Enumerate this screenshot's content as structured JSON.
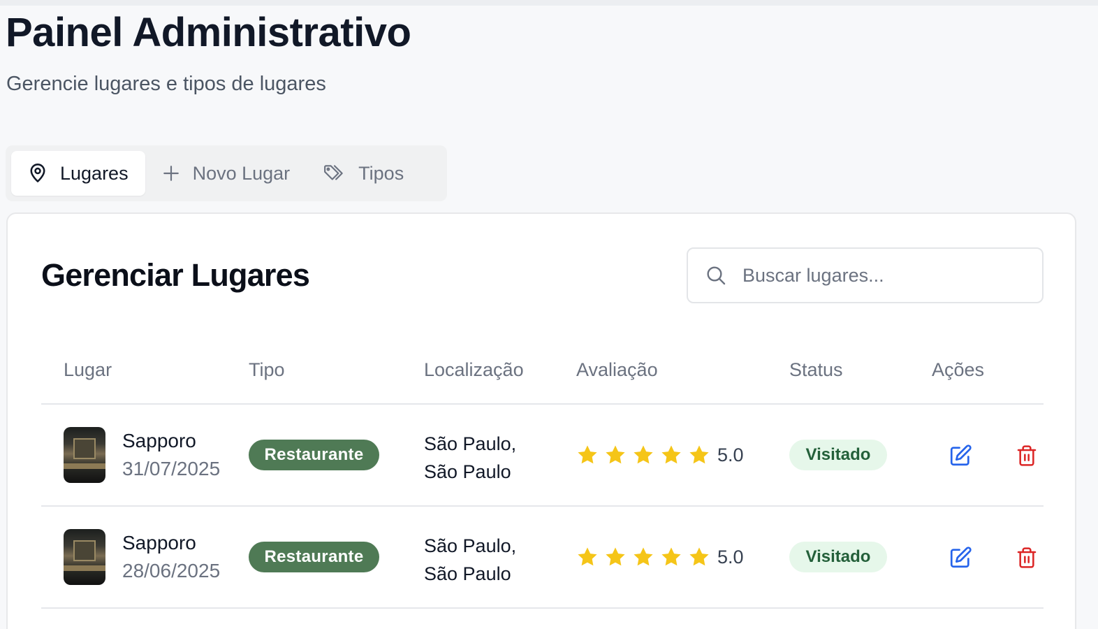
{
  "header": {
    "title": "Painel Administrativo",
    "subtitle": "Gerencie lugares e tipos de lugares"
  },
  "tabs": [
    {
      "label": "Lugares",
      "icon": "map-pin-icon",
      "active": true
    },
    {
      "label": "Novo Lugar",
      "icon": "plus-icon",
      "active": false
    },
    {
      "label": "Tipos",
      "icon": "tags-icon",
      "active": false
    }
  ],
  "card": {
    "title": "Gerenciar Lugares"
  },
  "search": {
    "placeholder": "Buscar lugares...",
    "value": "",
    "icon": "search-icon"
  },
  "table": {
    "columns": [
      "Lugar",
      "Tipo",
      "Localização",
      "Avaliação",
      "Status",
      "Ações"
    ],
    "rows": [
      {
        "name": "Sapporo",
        "date": "31/07/2025",
        "type": "Restaurante",
        "location_line1": "São Paulo,",
        "location_line2": "São Paulo",
        "stars": 5,
        "rating": "5.0",
        "status": "Visitado"
      },
      {
        "name": "Sapporo",
        "date": "28/06/2025",
        "type": "Restaurante",
        "location_line1": "São Paulo,",
        "location_line2": "São Paulo",
        "stars": 5,
        "rating": "5.0",
        "status": "Visitado"
      }
    ]
  },
  "colors": {
    "type_badge_bg": "#4f7a55",
    "status_badge_bg": "#e6f7ea",
    "status_badge_text": "#24603a",
    "star": "#f5c518",
    "edit_icon": "#2563eb",
    "delete_icon": "#dc2626"
  }
}
